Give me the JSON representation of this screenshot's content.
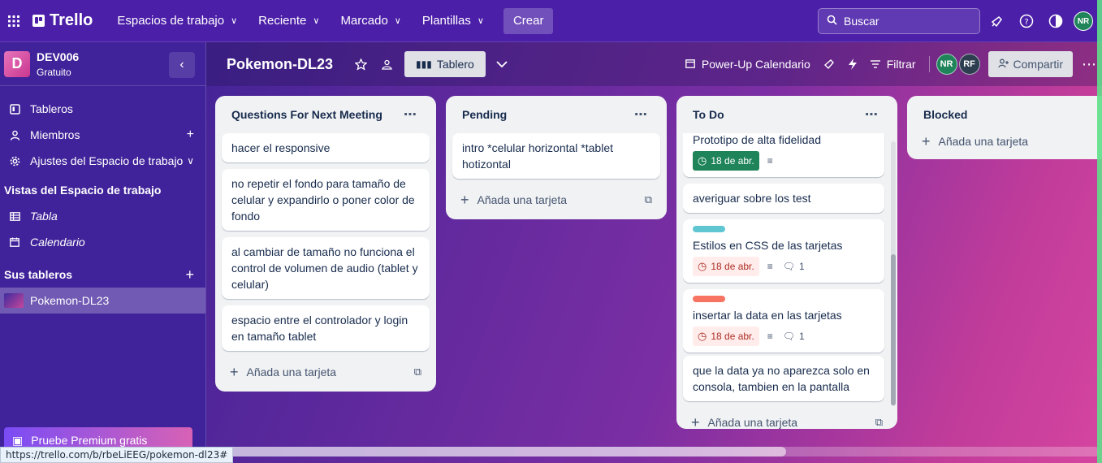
{
  "topnav": {
    "brand": "Trello",
    "menus": [
      {
        "label": "Espacios de trabajo"
      },
      {
        "label": "Reciente"
      },
      {
        "label": "Marcado"
      },
      {
        "label": "Plantillas"
      }
    ],
    "create_label": "Crear",
    "search_placeholder": "Buscar",
    "user_initials": "NR"
  },
  "sidebar": {
    "workspace_initial": "D",
    "workspace_name": "DEV006",
    "workspace_plan": "Gratuito",
    "items": [
      {
        "label": "Tableros"
      },
      {
        "label": "Miembros"
      },
      {
        "label": "Ajustes del Espacio de trabajo"
      }
    ],
    "views_title": "Vistas del Espacio de trabajo",
    "views": [
      {
        "label": "Tabla"
      },
      {
        "label": "Calendario"
      }
    ],
    "boards_title": "Sus tableros",
    "boards": [
      {
        "label": "Pokemon-DL23"
      }
    ],
    "premium_label": "Pruebe Premium gratis"
  },
  "board": {
    "title": "Pokemon-DL23",
    "view_label": "Tablero",
    "powerup_label": "Power-Up Calendario",
    "filter_label": "Filtrar",
    "members": [
      "NR",
      "RF"
    ],
    "share_label": "Compartir"
  },
  "lists": [
    {
      "title": "Questions For Next Meeting",
      "cards": [
        {
          "text": "hacer el responsive"
        },
        {
          "text": "no repetir el fondo para tamaño de celular y expandirlo o poner color de fondo"
        },
        {
          "text": "al cambiar de tamaño no funciona el control de volumen de audio (tablet y celular)"
        },
        {
          "text": "espacio entre el controlador y login en tamaño tablet"
        }
      ],
      "add_label": "Añada una tarjeta"
    },
    {
      "title": "Pending",
      "cards": [
        {
          "text": "intro *celular horizontal *tablet hotizontal"
        }
      ],
      "add_label": "Añada una tarjeta"
    },
    {
      "title": "To Do",
      "cards": [
        {
          "text": "Prototipo de alta fidelidad",
          "due": "18 de abr."
        },
        {
          "text": "averiguar sobre los test"
        },
        {
          "text": "Estilos en CSS de las tarjetas",
          "due": "18 de abr.",
          "comments": "1",
          "label_color": "#60c6d2"
        },
        {
          "text": "insertar la data en las tarjetas",
          "due": "18 de abr.",
          "comments": "1",
          "label_color": "#f87462"
        },
        {
          "text": "que la data ya no aparezca solo en consola, tambien en la pantalla"
        }
      ],
      "add_label": "Añada una tarjeta"
    },
    {
      "title": "Blocked",
      "cards": [],
      "add_label": "Añada una tarjeta"
    }
  ],
  "statusbar_url": "https://trello.com/b/rbeLiEEG/pokemon-dl23#",
  "colors": {
    "due_green": "#1f845a",
    "due_red_bg": "#ffeceb",
    "label_teal": "#60c6d2",
    "label_red": "#f87462"
  }
}
